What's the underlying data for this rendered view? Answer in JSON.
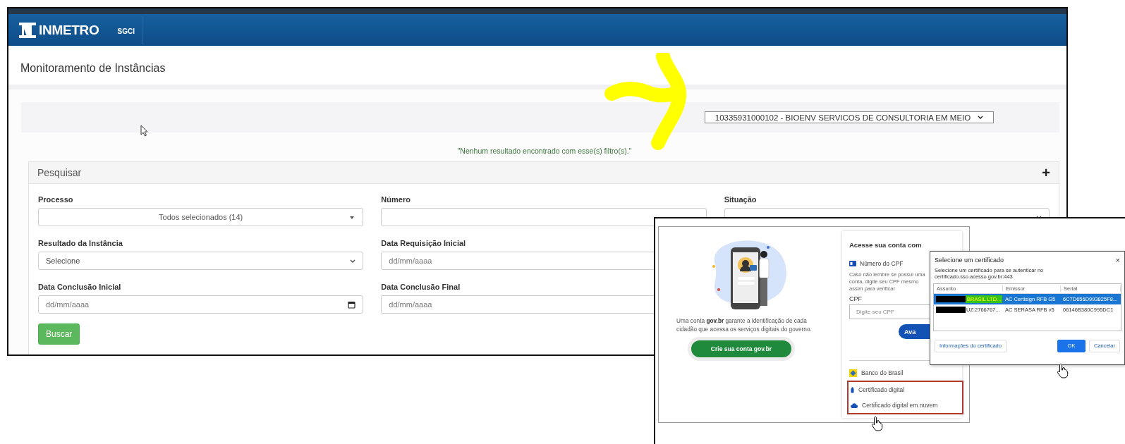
{
  "main_window": {
    "logo": "INMETRO",
    "app_name": "SGCI",
    "page_title": "Monitoramento de Instâncias",
    "company_select": {
      "value": "10335931000102 - BIOENV SERVICOS DE CONSULTORIA EM MEIO"
    },
    "message": "\"Nenhum resultado encontrado com esse(s) filtro(s).\"",
    "search_panel": {
      "title": "Pesquisar",
      "expand_icon": "+",
      "rows": [
        [
          {
            "label": "Processo",
            "kind": "multiselect",
            "value": "Todos selecionados (14)"
          },
          {
            "label": "Número",
            "kind": "text"
          },
          {
            "label": "Situação",
            "kind": "select"
          }
        ],
        [
          {
            "label": "Resultado da Instância",
            "kind": "select",
            "value": "Selecione"
          },
          {
            "label": "Data Requisição Inicial",
            "kind": "text",
            "placeholder": "dd/mm/aaaa"
          }
        ],
        [
          {
            "label": "Data Conclusão Inicial",
            "kind": "date",
            "placeholder": "dd/mm/aaaa"
          },
          {
            "label": "Data Conclusão Final",
            "kind": "text",
            "placeholder": "dd/mm/aaaa"
          }
        ]
      ],
      "search_button": "Buscar"
    }
  },
  "login_window": {
    "intro_text": "Uma conta **gov.br** garante a identificação de cada cidadão que acessa os serviços digitais do governo.",
    "create_account_button": "Crie sua conta gov.br",
    "card_title": "Acesse sua conta com",
    "cpf_option": "Número do CPF",
    "cpf_hint": "Caso não lembre se possui uma conta, digite seu CPF mesmo assim para verificar",
    "cpf_label": "CPF",
    "cpf_placeholder": "Digite seu CPF",
    "continue_button": "Ava",
    "other_options": [
      {
        "label": "Banco do Brasil",
        "kind": "bank",
        "highlighted": false
      },
      {
        "label": "Certificado digital",
        "kind": "certificate",
        "highlighted": true
      },
      {
        "label": "Certificado digital em nuvem",
        "kind": "cloud",
        "highlighted": true
      }
    ]
  },
  "certificate_dialog": {
    "title": "Selecione um certificado",
    "close": "×",
    "subtitle": "Selecione um certificado para se autenticar no certificado.sso.acesso.gov.br:443",
    "columns": [
      "Assunto",
      "Emissor",
      "Serial"
    ],
    "rows": [
      {
        "selected": true,
        "subject": {
          "redacted": true,
          "text": "BRASIL LTD...",
          "marker": true
        },
        "issuer": "AC Certisign RFB G5",
        "serial": "6C7D656D993825F8..."
      },
      {
        "selected": false,
        "subject": {
          "redacted": true,
          "text": "UZ:2766767...",
          "marker": false
        },
        "issuer": "AC SERASA RFB v5",
        "serial": "06146B380C995DC1"
      }
    ],
    "buttons": [
      {
        "label": "Informações do certificado",
        "primary": false
      },
      {
        "label": "OK",
        "primary": true
      },
      {
        "label": "Cancelar",
        "primary": false
      }
    ]
  }
}
